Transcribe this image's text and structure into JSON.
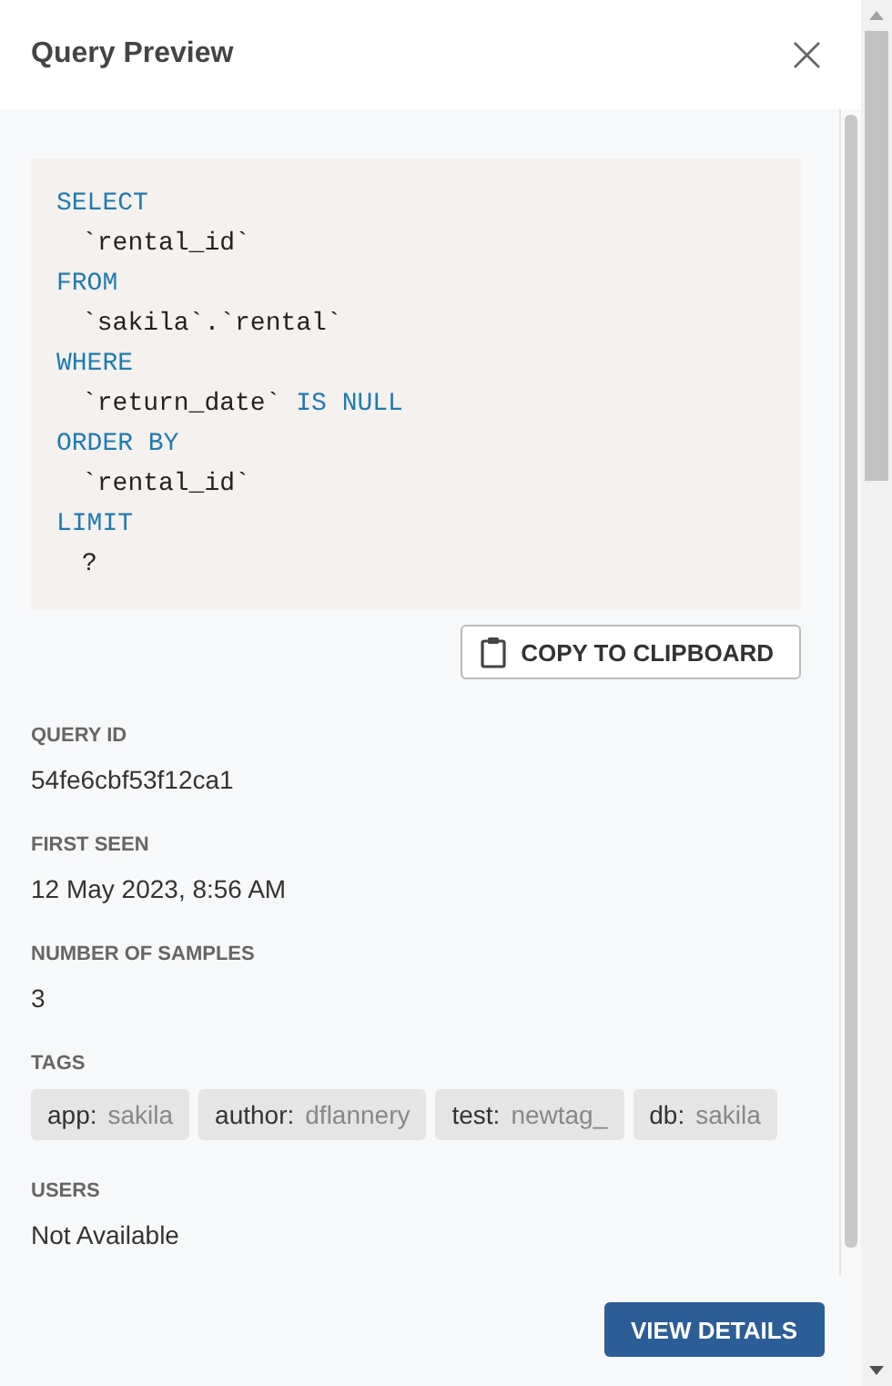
{
  "dialog": {
    "title": "Query Preview",
    "close": "×"
  },
  "code": [
    {
      "keyword": "SELECT",
      "body": [
        [
          {
            "kind": "identifier",
            "text": "`rental_id`"
          }
        ]
      ]
    },
    {
      "keyword": "FROM",
      "body": [
        [
          {
            "kind": "identifier",
            "text": "`sakila`.`rental`"
          }
        ]
      ]
    },
    {
      "keyword": "WHERE",
      "body": [
        [
          {
            "kind": "identifier",
            "text": "`return_date`"
          },
          {
            "kind": "keyword",
            "text": " IS NULL"
          }
        ]
      ]
    },
    {
      "keyword": "ORDER BY",
      "body": [
        [
          {
            "kind": "identifier",
            "text": "`rental_id`"
          }
        ]
      ]
    },
    {
      "keyword": "LIMIT",
      "body": [
        [
          {
            "kind": "identifier",
            "text": "?"
          }
        ]
      ]
    }
  ],
  "copy_button": "COPY TO CLIPBOARD",
  "fields": [
    {
      "kind": "text",
      "label": "QUERY ID",
      "value": "54fe6cbf53f12ca1"
    },
    {
      "kind": "text",
      "label": "FIRST SEEN",
      "value": "12 May 2023, 8:56 AM"
    },
    {
      "kind": "text",
      "label": "NUMBER OF SAMPLES",
      "value": "3"
    },
    {
      "kind": "tags",
      "label": "TAGS",
      "tags": [
        {
          "key": "app:",
          "value": "sakila"
        },
        {
          "key": "author:",
          "value": "dflannery"
        },
        {
          "key": "test:",
          "value": "newtag_"
        },
        {
          "key": "db:",
          "value": "sakila"
        }
      ]
    },
    {
      "kind": "text",
      "label": "USERS",
      "value": "Not Available"
    }
  ],
  "view_button": "VIEW DETAILS"
}
